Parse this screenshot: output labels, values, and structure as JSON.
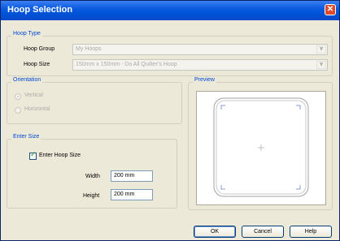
{
  "window": {
    "title": "Hoop Selection"
  },
  "hoop_type": {
    "legend": "Hoop Type",
    "group_label": "Hoop Group",
    "group_value": "My Hoops",
    "size_label": "Hoop Size",
    "size_value": "150mm x 150mm - Do All Quilter's Hoop"
  },
  "orientation": {
    "legend": "Orientation",
    "options": [
      {
        "label": "Vertical",
        "selected": true
      },
      {
        "label": "Horizontal",
        "selected": false
      }
    ]
  },
  "enter_size": {
    "legend": "Enter Size",
    "checkbox_label": "Enter Hoop Size",
    "checked": true,
    "width_label": "Width",
    "width_value": "200 mm",
    "height_label": "Height",
    "height_value": "200 mm"
  },
  "preview": {
    "legend": "Preview"
  },
  "buttons": {
    "ok": "OK",
    "cancel": "Cancel",
    "help": "Help"
  }
}
